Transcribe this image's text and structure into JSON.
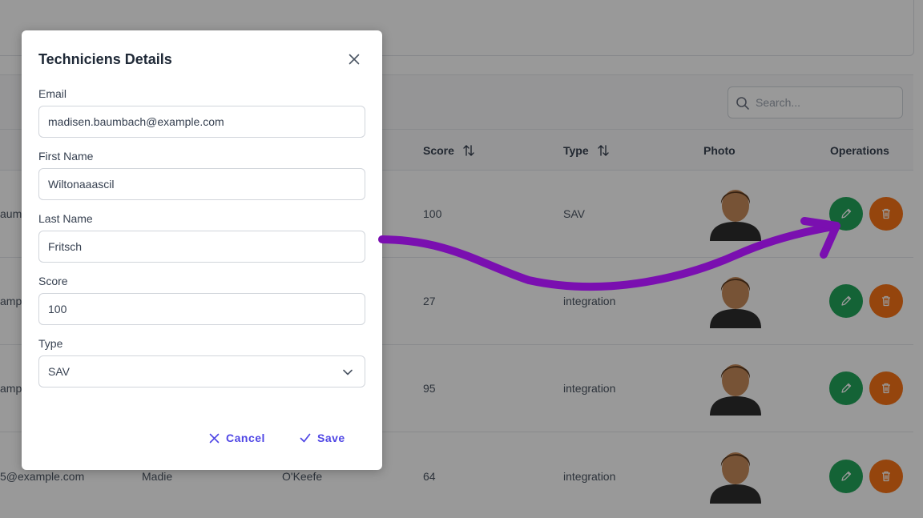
{
  "search": {
    "placeholder": "Search..."
  },
  "table": {
    "columns": {
      "score": "Score",
      "type": "Type",
      "photo": "Photo",
      "operations": "Operations"
    },
    "rows": [
      {
        "email_fragment": "aumb",
        "first_name": "",
        "last_name": "",
        "score": "100",
        "type": "SAV"
      },
      {
        "email_fragment": "amp",
        "first_name": "",
        "last_name": "",
        "score": "27",
        "type": "integration"
      },
      {
        "email_fragment": "amp",
        "first_name": "",
        "last_name": "",
        "score": "95",
        "type": "integration"
      },
      {
        "email_fragment": "5@example.com",
        "first_name": "Madie",
        "last_name": "O'Keefe",
        "score": "64",
        "type": "integration"
      }
    ]
  },
  "dialog": {
    "title": "Techniciens Details",
    "fields": {
      "email": {
        "label": "Email",
        "value": "madisen.baumbach@example.com"
      },
      "first_name": {
        "label": "First Name",
        "value": "Wiltonaaascil"
      },
      "last_name": {
        "label": "Last Name",
        "value": "Fritsch"
      },
      "score": {
        "label": "Score",
        "value": "100"
      },
      "type": {
        "label": "Type",
        "value": "SAV"
      }
    },
    "cancel_label": "Cancel",
    "save_label": "Save"
  },
  "colors": {
    "edit_button": "#22a55a",
    "delete_button": "#f97316",
    "accent": "#4f46e5",
    "annotation_arrow": "#7a0fb0"
  },
  "icons": [
    "search-icon",
    "sort-icon",
    "pencil-icon",
    "trash-icon",
    "close-icon",
    "chevron-down-icon",
    "times-icon",
    "check-icon",
    "avatar-icon"
  ]
}
